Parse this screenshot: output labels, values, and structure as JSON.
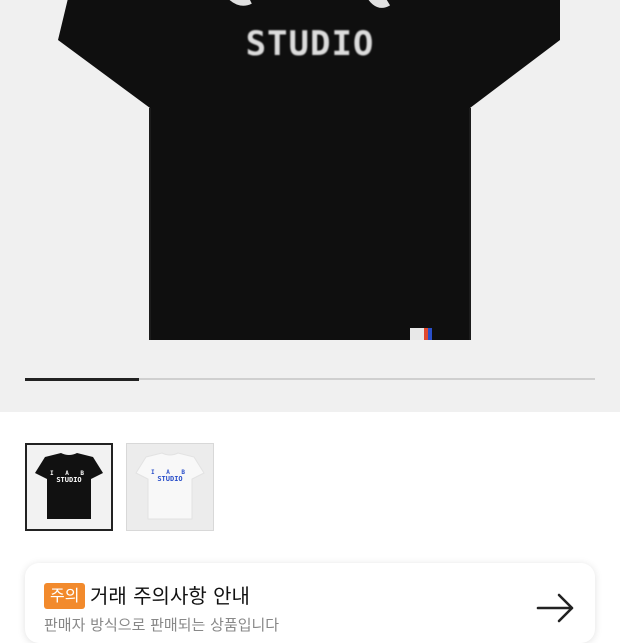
{
  "product": {
    "shirt_print": "STUDIO",
    "thumb_print_top": "I A B",
    "thumb_print": "STUDIO",
    "tag_text": "IB"
  },
  "gallery": {
    "progress": 0.2,
    "selected_index": 0,
    "thumbnails": [
      {
        "variant": "black",
        "color": "#111111",
        "print_color": "#ffffff"
      },
      {
        "variant": "white",
        "color": "#f6f6f6",
        "print_color": "#2a4fc9"
      }
    ]
  },
  "notice": {
    "badge": "주의",
    "title": "거래 주의사항 안내",
    "subtitle": "판매자 방식으로 판매되는 상품입니다"
  },
  "colors": {
    "accent_orange": "#f28a2c",
    "hero_bg": "#f0f0f0",
    "shirt_black": "#111111"
  },
  "icons": {
    "arrow": "arrow-right-icon"
  }
}
